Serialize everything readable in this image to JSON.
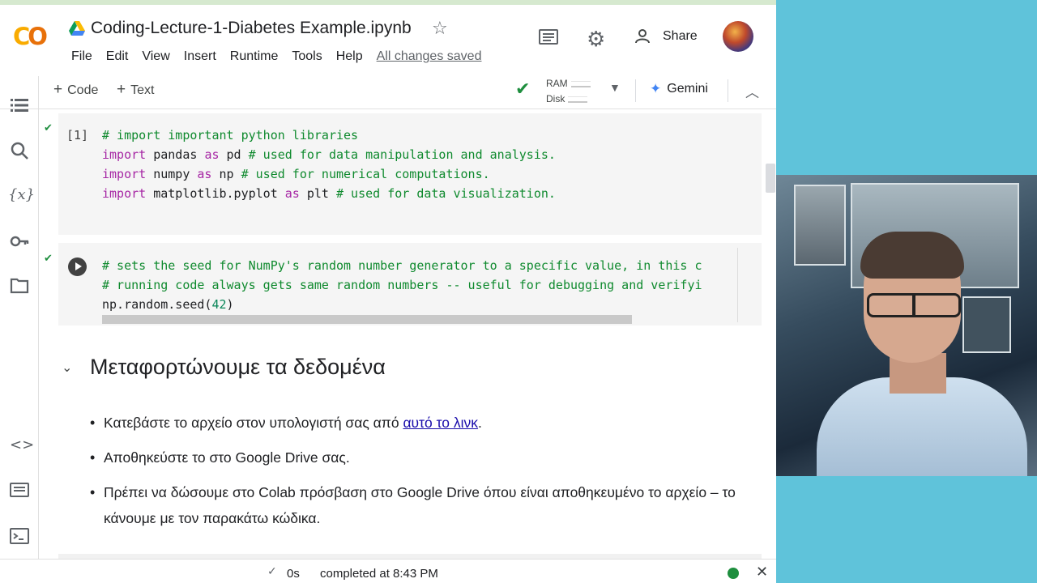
{
  "header": {
    "logo_part1": "C",
    "logo_part2": "O",
    "title": "Coding-Lecture-1-Diabetes Example.ipynb",
    "star_glyph": "☆",
    "share_label": "Share",
    "menu": [
      "File",
      "Edit",
      "View",
      "Insert",
      "Runtime",
      "Tools",
      "Help"
    ],
    "saved_status": "All changes saved"
  },
  "toolbar": {
    "add_code_label": "Code",
    "add_text_label": "Text",
    "ram_label": "RAM",
    "disk_label": "Disk",
    "gemini_label": "Gemini"
  },
  "sidebar": {
    "icons": [
      "table-of-contents-icon",
      "search-icon",
      "variables-icon",
      "secrets-key-icon",
      "files-folder-icon",
      "code-snippets-icon",
      "command-palette-icon",
      "terminal-icon"
    ]
  },
  "cells": {
    "cell1": {
      "exec_count": "[1]",
      "lines": [
        {
          "comment": "# import important python libraries"
        },
        {
          "kw1": "import",
          "mod": " pandas ",
          "kw2": "as",
          "alias": " pd ",
          "comment": "# used for data manipulation and analysis."
        },
        {
          "kw1": "import",
          "mod": " numpy ",
          "kw2": "as",
          "alias": " np ",
          "comment": "# used for numerical computations."
        },
        {
          "kw1": "import",
          "mod": " matplotlib.pyplot ",
          "kw2": "as",
          "alias": " plt ",
          "comment": "# used for data visualization."
        }
      ]
    },
    "cell2": {
      "line1": "# sets the seed for NumPy's random number generator to a specific value, in this c",
      "line2": "# running code always gets same random numbers -- useful for debugging and verifyi",
      "line3_call": "np.random.seed(",
      "line3_arg": "42",
      "line3_close": ")"
    }
  },
  "markdown": {
    "heading": "Μεταφορτώνουμε τα δεδομένα",
    "bullet1_text": "Κατεβάστε το αρχείο στον υπολογιστή σας από ",
    "bullet1_link": "αυτό το λινκ",
    "bullet1_end": ".",
    "bullet2": "Αποθηκεύστε το στο Google Drive σας.",
    "bullet3": "Πρέπει να δώσουμε στο Colab πρόσβαση στο Google Drive όπου είναι αποθηκευμένο το αρχείο – το κάνουμε με τον παρακάτω κώδικα."
  },
  "status": {
    "duration": "0s",
    "completed": "completed at 8:43 PM"
  },
  "colors": {
    "accent_green": "#1e8e3e",
    "background_cyan": "#5fc3da",
    "logo_yellow": "#f9ab00",
    "logo_orange": "#e8710a"
  }
}
